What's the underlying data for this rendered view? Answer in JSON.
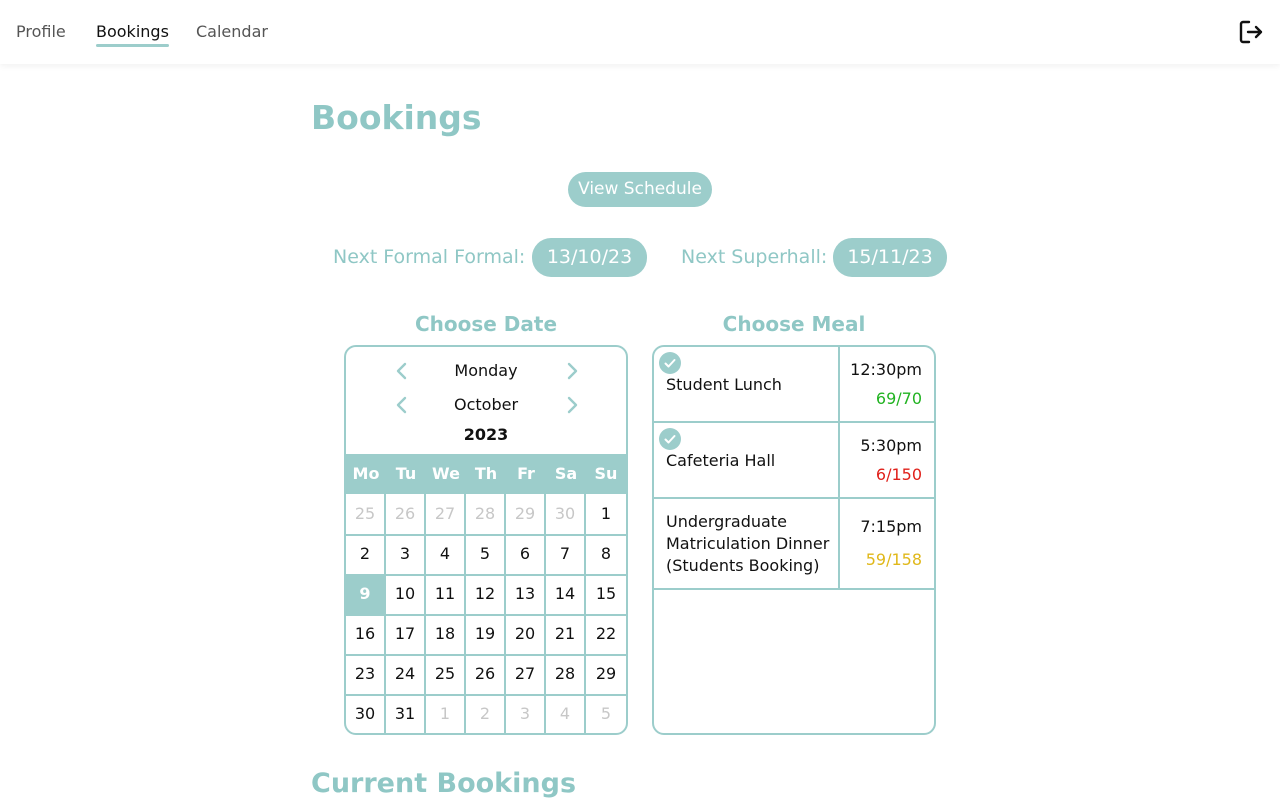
{
  "nav": {
    "tabs": [
      "Profile",
      "Bookings",
      "Calendar"
    ],
    "active": "Bookings",
    "logout_icon": "logout-icon"
  },
  "page": {
    "title": "Bookings",
    "view_schedule_label": "View Schedule",
    "next_formal_label": "Next Formal Formal:",
    "next_formal_date": "13/10/23",
    "next_superhall_label": "Next Superhall:",
    "next_superhall_date": "15/11/23",
    "choose_date_label": "Choose Date",
    "choose_meal_label": "Choose Meal",
    "current_bookings_label": "Current Bookings"
  },
  "calendar": {
    "weekday": "Monday",
    "month": "October",
    "year": "2023",
    "headers": [
      "Mo",
      "Tu",
      "We",
      "Th",
      "Fr",
      "Sa",
      "Su"
    ],
    "weeks": [
      [
        {
          "d": "25",
          "other": true
        },
        {
          "d": "26",
          "other": true
        },
        {
          "d": "27",
          "other": true
        },
        {
          "d": "28",
          "other": true
        },
        {
          "d": "29",
          "other": true
        },
        {
          "d": "30",
          "other": true
        },
        {
          "d": "1"
        }
      ],
      [
        {
          "d": "2"
        },
        {
          "d": "3"
        },
        {
          "d": "4"
        },
        {
          "d": "5"
        },
        {
          "d": "6"
        },
        {
          "d": "7"
        },
        {
          "d": "8"
        }
      ],
      [
        {
          "d": "9",
          "selected": true
        },
        {
          "d": "10"
        },
        {
          "d": "11"
        },
        {
          "d": "12"
        },
        {
          "d": "13"
        },
        {
          "d": "14"
        },
        {
          "d": "15"
        }
      ],
      [
        {
          "d": "16"
        },
        {
          "d": "17"
        },
        {
          "d": "18"
        },
        {
          "d": "19"
        },
        {
          "d": "20"
        },
        {
          "d": "21"
        },
        {
          "d": "22"
        }
      ],
      [
        {
          "d": "23"
        },
        {
          "d": "24"
        },
        {
          "d": "25"
        },
        {
          "d": "26"
        },
        {
          "d": "27"
        },
        {
          "d": "28"
        },
        {
          "d": "29"
        }
      ],
      [
        {
          "d": "30"
        },
        {
          "d": "31"
        },
        {
          "d": "1",
          "other": true
        },
        {
          "d": "2",
          "other": true
        },
        {
          "d": "3",
          "other": true
        },
        {
          "d": "4",
          "other": true
        },
        {
          "d": "5",
          "other": true
        }
      ]
    ]
  },
  "meals": [
    {
      "name": "Student Lunch",
      "time": "12:30pm",
      "count": "69/70",
      "count_color": "#22b322",
      "booked": true
    },
    {
      "name": "Cafeteria Hall",
      "time": "5:30pm",
      "count": "6/150",
      "count_color": "#e0201a",
      "booked": true
    },
    {
      "name": "Undergraduate Matriculation Dinner (Students Booking)",
      "time": "7:15pm",
      "count": "59/158",
      "count_color": "#e0b81a",
      "booked": false
    }
  ],
  "colors": {
    "accent": "#9ccdcb"
  }
}
